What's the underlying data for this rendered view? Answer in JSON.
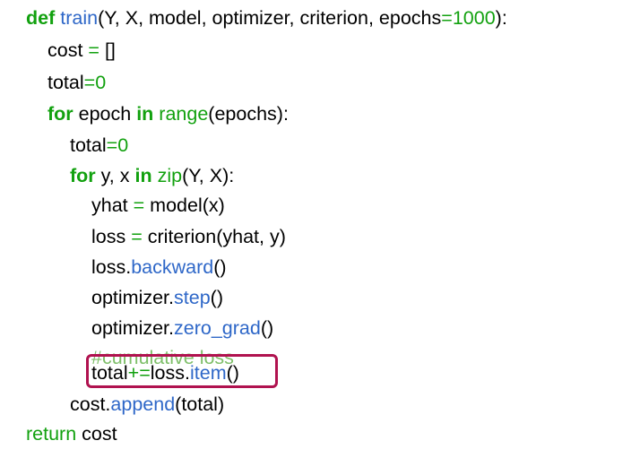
{
  "colors": {
    "keyword": "#12a10f",
    "function": "#2e67c8",
    "number": "#12a10f",
    "operator": "#12a10f",
    "comment": "#7fbf6a",
    "text": "#000000",
    "highlight_border": "#b0124f"
  },
  "code": {
    "lines": [
      {
        "tokens": [
          {
            "t": "def",
            "c": "keyword",
            "b": true
          },
          {
            "t": " ",
            "c": "text"
          },
          {
            "t": "train",
            "c": "function"
          },
          {
            "t": "(Y, X, model, optimizer, criterion, epochs",
            "c": "text"
          },
          {
            "t": "=",
            "c": "operator"
          },
          {
            "t": "1000",
            "c": "number"
          },
          {
            "t": "):",
            "c": "text"
          }
        ]
      },
      {
        "tokens": [
          {
            "t": "cost ",
            "c": "text"
          },
          {
            "t": "=",
            "c": "operator"
          },
          {
            "t": " []",
            "c": "text"
          }
        ]
      },
      {
        "tokens": [
          {
            "t": "total",
            "c": "text"
          },
          {
            "t": "=",
            "c": "operator"
          },
          {
            "t": "0",
            "c": "number"
          }
        ]
      },
      {
        "tokens": [
          {
            "t": "for",
            "c": "keyword",
            "b": true
          },
          {
            "t": " epoch ",
            "c": "text"
          },
          {
            "t": "in",
            "c": "keyword",
            "b": true
          },
          {
            "t": " ",
            "c": "text"
          },
          {
            "t": "range",
            "c": "keyword"
          },
          {
            "t": "(epochs):",
            "c": "text"
          }
        ]
      },
      {
        "tokens": [
          {
            "t": "total",
            "c": "text"
          },
          {
            "t": "=",
            "c": "operator"
          },
          {
            "t": "0",
            "c": "number"
          }
        ]
      },
      {
        "tokens": [
          {
            "t": "for",
            "c": "keyword",
            "b": true
          },
          {
            "t": " y, x ",
            "c": "text"
          },
          {
            "t": "in",
            "c": "keyword",
            "b": true
          },
          {
            "t": " ",
            "c": "text"
          },
          {
            "t": "zip",
            "c": "keyword"
          },
          {
            "t": "(Y, X):",
            "c": "text"
          }
        ]
      },
      {
        "tokens": [
          {
            "t": "yhat ",
            "c": "text"
          },
          {
            "t": "=",
            "c": "operator"
          },
          {
            "t": " model(x)",
            "c": "text"
          }
        ]
      },
      {
        "tokens": [
          {
            "t": "loss ",
            "c": "text"
          },
          {
            "t": "=",
            "c": "operator"
          },
          {
            "t": " criterion(yhat, y)",
            "c": "text"
          }
        ]
      },
      {
        "tokens": [
          {
            "t": "loss.",
            "c": "text"
          },
          {
            "t": "backward",
            "c": "function"
          },
          {
            "t": "()",
            "c": "text"
          }
        ]
      },
      {
        "tokens": [
          {
            "t": "optimizer.",
            "c": "text"
          },
          {
            "t": "step",
            "c": "function"
          },
          {
            "t": "()",
            "c": "text"
          }
        ]
      },
      {
        "tokens": [
          {
            "t": "optimizer.",
            "c": "text"
          },
          {
            "t": "zero_grad",
            "c": "function"
          },
          {
            "t": "()",
            "c": "text"
          }
        ]
      },
      {
        "tokens": [
          {
            "t": "#cumulative loss",
            "c": "comment"
          }
        ]
      },
      {
        "tokens": [
          {
            "t": "total",
            "c": "text"
          },
          {
            "t": "+=",
            "c": "operator"
          },
          {
            "t": "loss.",
            "c": "text"
          },
          {
            "t": "item",
            "c": "function"
          },
          {
            "t": "()",
            "c": "text"
          }
        ]
      },
      {
        "tokens": [
          {
            "t": "cost.",
            "c": "text"
          },
          {
            "t": "append",
            "c": "function"
          },
          {
            "t": "(total)",
            "c": "text"
          }
        ]
      },
      {
        "tokens": [
          {
            "t": "return",
            "c": "keyword"
          },
          {
            "t": " cost",
            "c": "text"
          }
        ]
      }
    ]
  }
}
